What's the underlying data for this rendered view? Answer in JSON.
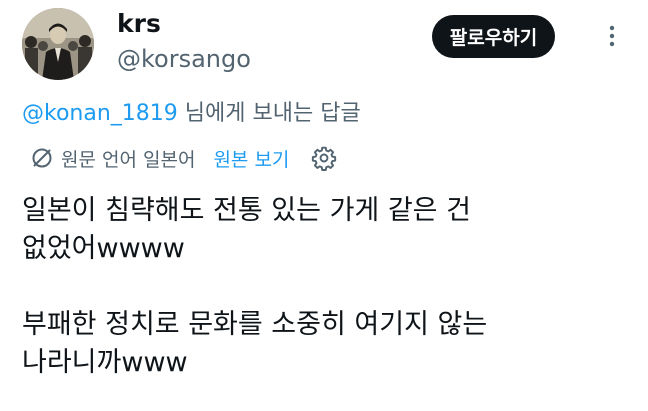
{
  "author": {
    "display_name": "krs",
    "handle": "@korsango"
  },
  "actions": {
    "follow_label": "팔로우하기"
  },
  "reply_context": {
    "mention": "@konan_1819",
    "suffix": " 님에게 보내는 답글"
  },
  "translation": {
    "source_label": "원문 언어 일본어",
    "show_original_label": "원본 보기"
  },
  "tweet": {
    "line1": "일본이 침략해도 전통 있는 가게 같은 건",
    "line2": "없었어wwww",
    "line3": "부패한 정치로 문화를 소중히 여기지 않는",
    "line4": "나라니까www"
  },
  "colors": {
    "text_primary": "#0f1419",
    "text_secondary": "#536471",
    "link": "#1d9bf0",
    "button_bg": "#0f1419"
  },
  "icons": [
    "avatar-image",
    "more-options-icon",
    "translate-icon",
    "settings-gear-icon"
  ]
}
